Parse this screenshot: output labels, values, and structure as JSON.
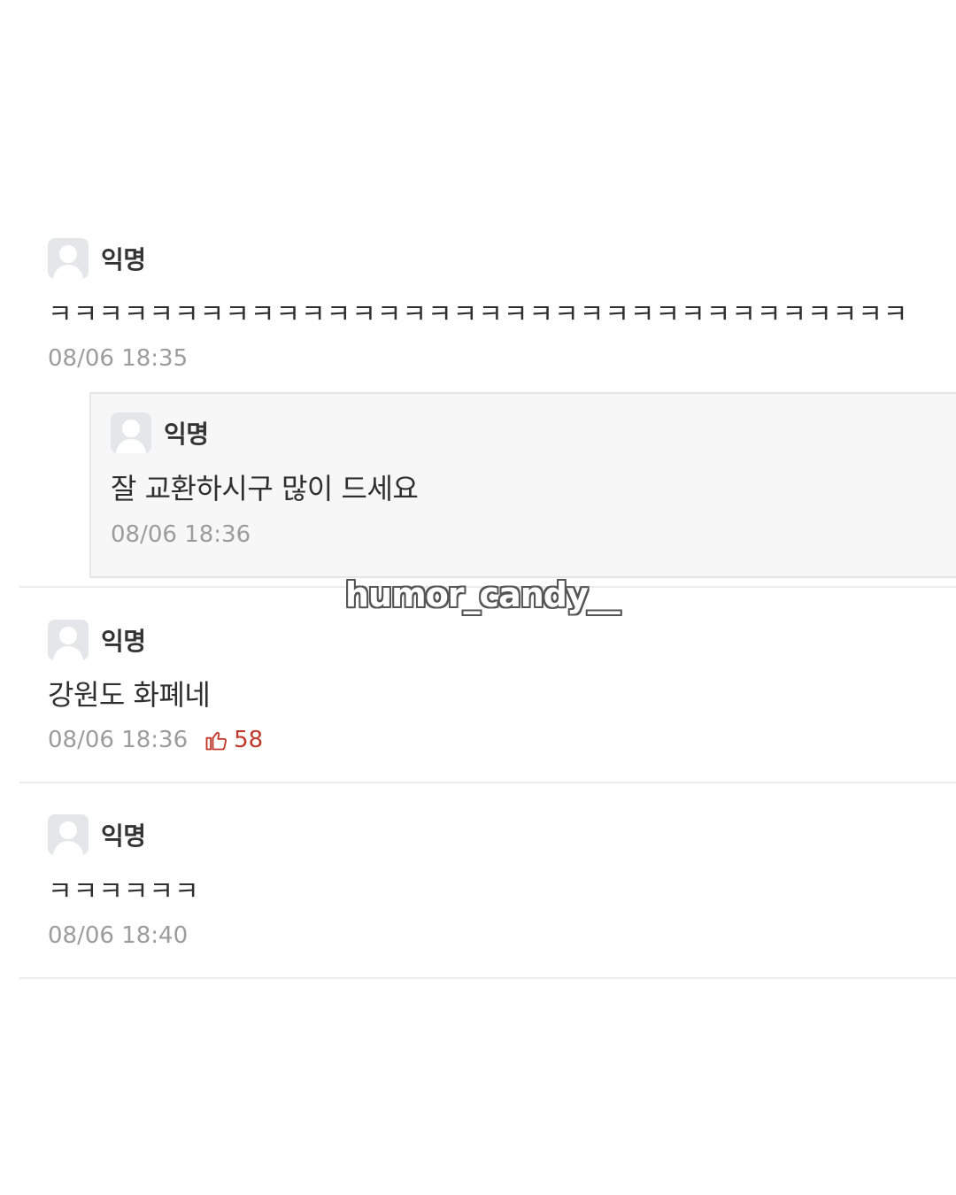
{
  "comments": [
    {
      "author": "익명",
      "text": "ㅋㅋㅋㅋㅋㅋㅋㅋㅋㅋㅋㅋㅋㅋㅋㅋㅋㅋㅋㅋㅋㅋㅋㅋㅋㅋㅋㅋㅋㅋㅋㅋㅋㅋ",
      "timestamp": "08/06 18:35"
    },
    {
      "author": "익명",
      "text": "잘 교환하시구 많이 드세요",
      "timestamp": "08/06 18:36"
    },
    {
      "author": "익명",
      "text": "강원도 화폐네",
      "timestamp": "08/06 18:36",
      "vote_count": "58"
    },
    {
      "author": "익명",
      "text": "ㅋㅋㅋㅋㅋㅋ",
      "timestamp": "08/06 18:40"
    }
  ],
  "watermark": "humor_candy__",
  "colors": {
    "vote": "#c0392b",
    "meta": "#9c9c9c",
    "reply_background": "#f7f7f7"
  },
  "icons": {
    "avatar": "default-user-icon",
    "vote": "thumbs-up-icon"
  }
}
